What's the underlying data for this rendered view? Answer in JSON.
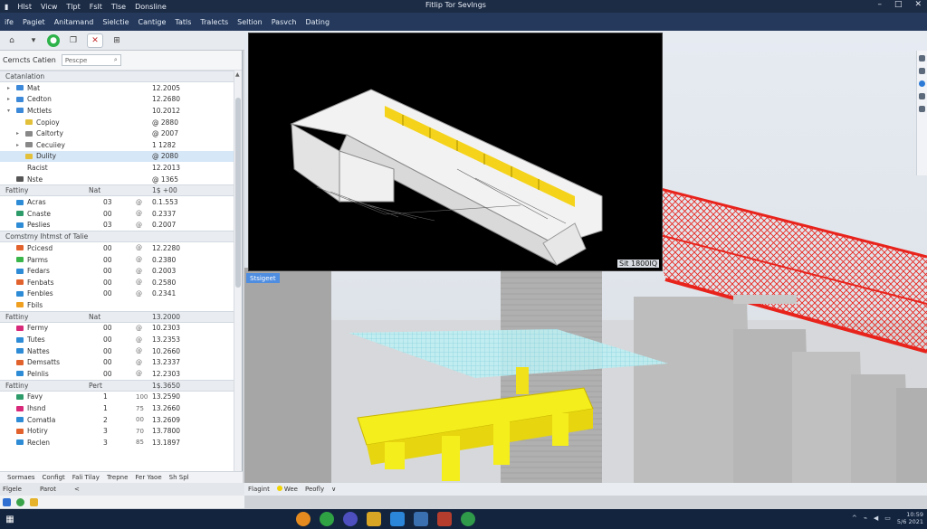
{
  "window": {
    "menu1": [
      "Hlst",
      "Vicw",
      "Tlpt",
      "Fslt",
      "Tlse",
      "Donsline"
    ],
    "title": "Fitlip Tor Sevlngs",
    "controls": [
      "–",
      "□",
      "✕"
    ]
  },
  "menubar": [
    "ife",
    "Pagiet",
    "Anitamand",
    "Sielctie",
    "Cantige",
    "Tatls",
    "Tralects",
    "Seltion",
    "Pasvch",
    "Dating"
  ],
  "left_panel": {
    "header_label": "Cerncts Catien",
    "search_placeholder": "Pescpe",
    "sections": [
      {
        "title": "Catanlation",
        "cols": [
          "",
          ""
        ],
        "rows": [
          {
            "label": "Mat",
            "v3": "12.2005",
            "indent": 1,
            "icon": "#3c88d9",
            "exp": "▸"
          },
          {
            "label": "Cedton",
            "v3": "12.2680",
            "indent": 1,
            "icon": "#3c88d9",
            "exp": "▸"
          },
          {
            "label": "Mctlets",
            "v3": "10.2012",
            "indent": 1,
            "icon": "#3c88d9",
            "exp": "▾"
          },
          {
            "label": "Copioy",
            "v3": "@ 2880",
            "indent": 2,
            "icon": "#e2c03a",
            "exp": ""
          },
          {
            "label": "Caltorty",
            "v3": "@ 2007",
            "indent": 2,
            "icon": "#888",
            "exp": "▸"
          },
          {
            "label": "Cecuiiey",
            "v3": "1 1282",
            "indent": 2,
            "icon": "#888",
            "exp": "▸"
          },
          {
            "label": "Dulity",
            "v3": "@ 2080",
            "indent": 2,
            "icon": "#e2c03a",
            "exp": "",
            "selected": true
          },
          {
            "label": "Racist",
            "v3": "12.2013",
            "indent": 1,
            "icon": "",
            "exp": ""
          },
          {
            "label": "Nste",
            "v3": "@ 1365",
            "indent": 1,
            "icon": "#555",
            "exp": ""
          }
        ]
      },
      {
        "title": "Fattiny",
        "cols": [
          "Nat",
          "1$ +00"
        ],
        "rows": [
          {
            "label": "Acras",
            "v1": "03",
            "v2": "@",
            "v3": "0.1.553",
            "icon": "#2e8bd6"
          },
          {
            "label": "Cnaste",
            "v1": "00",
            "v2": "@",
            "v3": "0.2337",
            "icon": "#2e9b6a"
          },
          {
            "label": "Peslies",
            "v1": "03",
            "v2": "@",
            "v3": "0.2007",
            "icon": "#2e8bd6"
          }
        ]
      },
      {
        "title": "Comstrny Ihtmst of Talie",
        "cols": [
          "",
          ""
        ],
        "rows": [
          {
            "label": "Pcicesd",
            "v1": "00",
            "v2": "@",
            "v3": "12.2280",
            "icon": "#e2622e"
          },
          {
            "label": "Parms",
            "v1": "00",
            "v2": "@",
            "v3": "0.2380",
            "icon": "#3ab54a"
          },
          {
            "label": "Fedars",
            "v1": "00",
            "v2": "@",
            "v3": "0.2003",
            "icon": "#2e8bd6"
          },
          {
            "label": "Fenbats",
            "v1": "00",
            "v2": "@",
            "v3": "0.2580",
            "icon": "#e2622e"
          },
          {
            "label": "Fenbles",
            "v1": "00",
            "v2": "@",
            "v3": "0.2341",
            "icon": "#2e8bd6"
          },
          {
            "label": "Fbils",
            "v1": "",
            "v2": "",
            "v3": "",
            "icon": "#f0a020"
          }
        ]
      },
      {
        "title": "Fattiny",
        "cols": [
          "Nat",
          "13.2000"
        ],
        "rows": [
          {
            "label": "Fermy",
            "v1": "00",
            "v2": "@",
            "v3": "10.2303",
            "icon": "#d8287a"
          },
          {
            "label": "Tutes",
            "v1": "00",
            "v2": "@",
            "v3": "13.2353",
            "icon": "#2e8bd6"
          },
          {
            "label": "Nattes",
            "v1": "00",
            "v2": "@",
            "v3": "10.2660",
            "icon": "#2e8bd6"
          },
          {
            "label": "Demsatts",
            "v1": "00",
            "v2": "@",
            "v3": "13.2337",
            "icon": "#e2622e"
          },
          {
            "label": "Pelnlis",
            "v1": "00",
            "v2": "@",
            "v3": "12.2303",
            "icon": "#2e8bd6"
          }
        ]
      },
      {
        "title": "Fattiny",
        "cols": [
          "Pert",
          "1$.3650"
        ],
        "rows": [
          {
            "label": "Favy",
            "v1": "1",
            "v2": "100",
            "v3": "13.2590",
            "icon": "#2e9b6a"
          },
          {
            "label": "Ihsnd",
            "v1": "1",
            "v2": "75",
            "v3": "13.2660",
            "icon": "#d8287a"
          },
          {
            "label": "Comatla",
            "v1": "2",
            "v2": "00",
            "v3": "13.2609",
            "icon": "#2e8bd6"
          },
          {
            "label": "Hotiry",
            "v1": "3",
            "v2": "70",
            "v3": "13.7800",
            "icon": "#e2622e"
          },
          {
            "label": "Reclen",
            "v1": "3",
            "v2": "85",
            "v3": "13.1897",
            "icon": "#2e8bd6"
          }
        ]
      }
    ],
    "status": [
      "Sormaes",
      "Configt",
      "Fali Tilay",
      "Trepne",
      "Fer Yaoe",
      "Sh Spl"
    ]
  },
  "viewport": {
    "inset_label": "Sit 1800IQ",
    "tab_label": "Stsigeet",
    "status": [
      "Flagint",
      "Wee",
      "Peofly",
      "∨"
    ]
  },
  "bottom_left": {
    "items": [
      "Flgele",
      "Parot",
      "<"
    ]
  },
  "colors": {
    "titlebar": "#1d2c45",
    "menubar": "#24395c",
    "yellow_beam": "#f5ee1d",
    "red_truss": "#e8231c",
    "glass": "#9fe0ea",
    "concrete": "#b9b9b9"
  },
  "taskbar": {
    "clock_line1": "10:59",
    "clock_line2": "5/6 2021"
  }
}
